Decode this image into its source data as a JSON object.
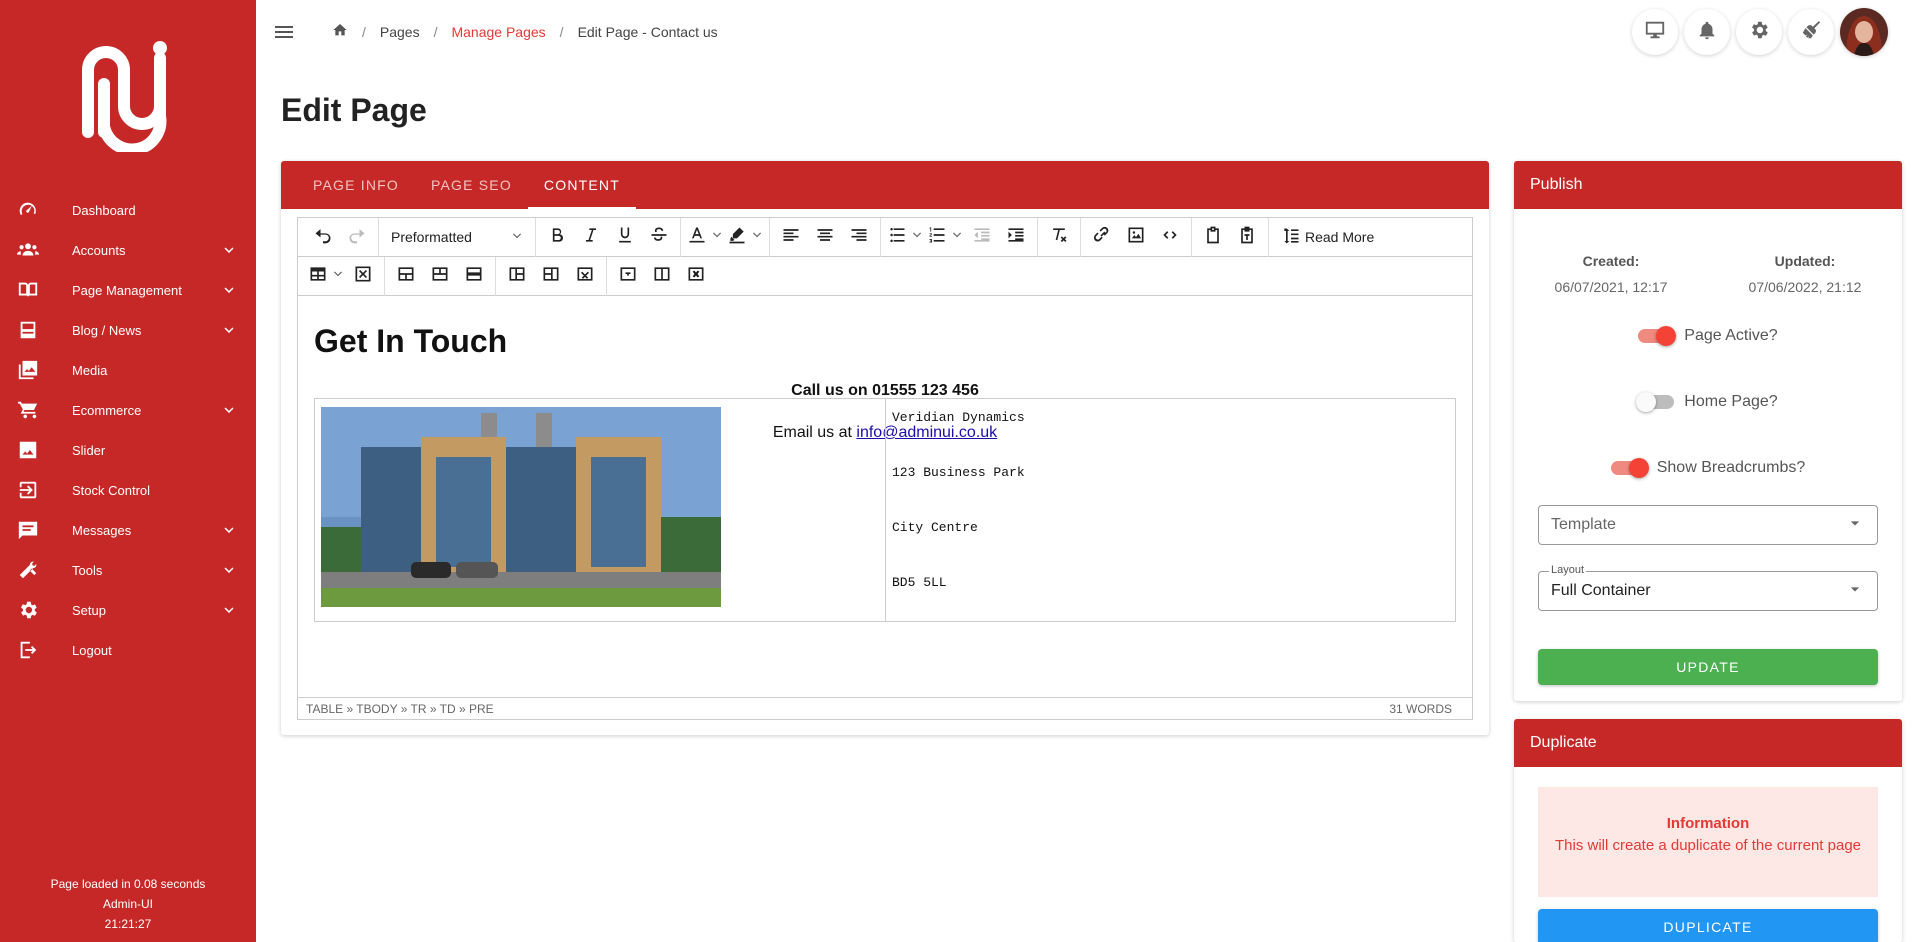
{
  "sidebar": {
    "items": [
      {
        "label": "Dashboard",
        "icon": "speedometer-icon",
        "expandable": false
      },
      {
        "label": "Accounts",
        "icon": "users-icon",
        "expandable": true
      },
      {
        "label": "Page Management",
        "icon": "book-open-icon",
        "expandable": true
      },
      {
        "label": "Blog / News",
        "icon": "newspaper-icon",
        "expandable": true
      },
      {
        "label": "Media",
        "icon": "images-icon",
        "expandable": false
      },
      {
        "label": "Ecommerce",
        "icon": "cart-icon",
        "expandable": true
      },
      {
        "label": "Slider",
        "icon": "image-icon",
        "expandable": false
      },
      {
        "label": "Stock Control",
        "icon": "import-icon",
        "expandable": false
      },
      {
        "label": "Messages",
        "icon": "message-icon",
        "expandable": true
      },
      {
        "label": "Tools",
        "icon": "tools-icon",
        "expandable": true
      },
      {
        "label": "Setup",
        "icon": "gear-icon",
        "expandable": true
      },
      {
        "label": "Logout",
        "icon": "logout-icon",
        "expandable": false
      }
    ],
    "footer": {
      "load_time": "Page loaded in 0.08 seconds",
      "app_name": "Admin-UI",
      "time": "21:21:27"
    }
  },
  "breadcrumb": {
    "pages": "Pages",
    "manage_pages": "Manage Pages",
    "current": "Edit Page - Contact us"
  },
  "page": {
    "title": "Edit Page"
  },
  "tabs": [
    "PAGE INFO",
    "PAGE SEO",
    "CONTENT"
  ],
  "editor": {
    "block_format": "Preformatted",
    "read_more": "Read More",
    "heading": "Get In Touch",
    "call_prefix": "Call us on ",
    "call_number": "01555 123 456",
    "email_prefix": "Email us at ",
    "email_link": "info@adminui.co.uk",
    "address": [
      "Veridian Dynamics",
      "123 Business Park",
      "City Centre",
      "BD5 5LL"
    ],
    "path": "TABLE » TBODY » TR » TD » PRE",
    "word_count": "31 WORDS"
  },
  "publish": {
    "header": "Publish",
    "created_label": "Created:",
    "created_value": "06/07/2021, 12:17",
    "updated_label": "Updated:",
    "updated_value": "07/06/2022, 21:12",
    "page_active_label": "Page Active?",
    "page_active": true,
    "home_page_label": "Home Page?",
    "home_page": false,
    "breadcrumbs_label": "Show Breadcrumbs?",
    "breadcrumbs": true,
    "template_placeholder": "Template",
    "layout_label": "Layout",
    "layout_value": "Full Container",
    "update_button": "UPDATE"
  },
  "duplicate": {
    "header": "Duplicate",
    "info_title": "Information",
    "info_text": "This will create a duplicate of the current page",
    "button": "DUPLICATE"
  },
  "colors": {
    "brand": "#c62828",
    "accent": "#e53935",
    "update": "#4caf50",
    "duplicate": "#2196f3"
  }
}
